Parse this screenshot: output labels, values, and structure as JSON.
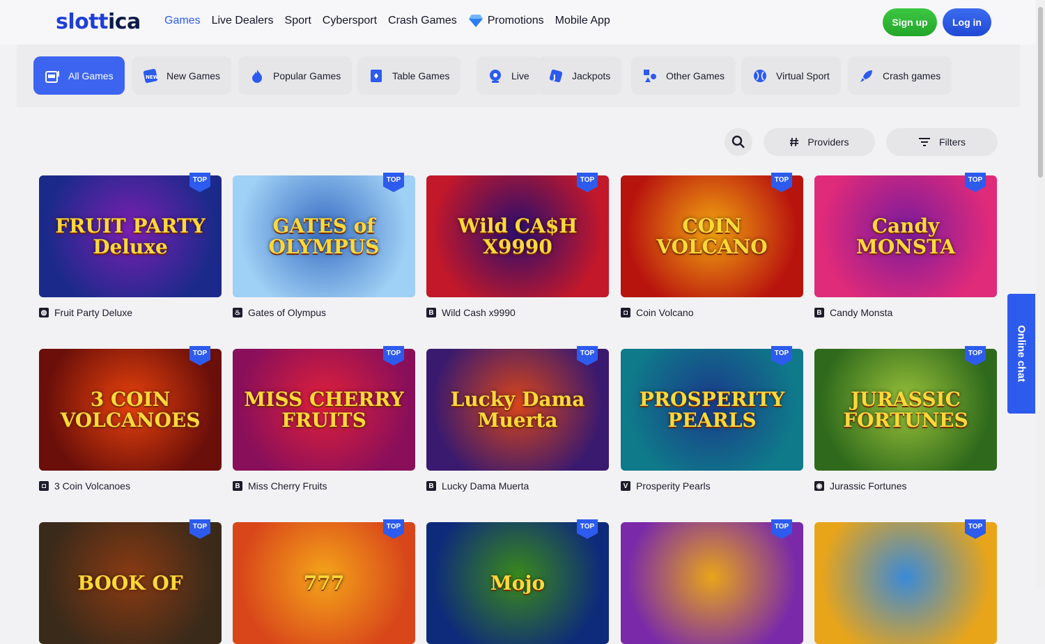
{
  "logo": {
    "part1": "slott",
    "part2": "ica"
  },
  "nav": {
    "items": [
      {
        "label": "Games",
        "active": true
      },
      {
        "label": "Live Dealers"
      },
      {
        "label": "Sport"
      },
      {
        "label": "Cybersport"
      },
      {
        "label": "Crash Games"
      },
      {
        "label": "Promotions",
        "icon": "diamond-icon"
      },
      {
        "label": "Mobile App"
      }
    ]
  },
  "auth": {
    "signup": "Sign up",
    "login": "Log in"
  },
  "categories": [
    {
      "label": "All Games",
      "icon": "slot-machine-icon",
      "active": true
    },
    {
      "label": "New Games",
      "icon": "new-icon"
    },
    {
      "label": "Popular Games",
      "icon": "fire-icon"
    },
    {
      "label": "Table Games",
      "icon": "card-icon"
    },
    {
      "label": "Live",
      "icon": "live-icon"
    },
    {
      "label": "Jackpots",
      "icon": "jackpot-icon"
    },
    {
      "label": "Other Games",
      "icon": "shapes-icon"
    },
    {
      "label": "Virtual Sport",
      "icon": "ball-icon"
    },
    {
      "label": "Crash games",
      "icon": "rocket-icon"
    }
  ],
  "toolbar": {
    "providers": "Providers",
    "filters": "Filters"
  },
  "badge": "TOP",
  "games": [
    {
      "title": "Fruit Party Deluxe",
      "art": "FRUIT PARTY Deluxe",
      "provider_glyph": "◍",
      "bg1": "#1b2a8a",
      "bg2": "#7a1fb0"
    },
    {
      "title": "Gates of Olympus",
      "art": "GATES of OLYMPUS",
      "provider_glyph": "♨",
      "bg1": "#9fd0f5",
      "bg2": "#3a6fc4"
    },
    {
      "title": "Wild Cash x9990",
      "art": "Wild CA$H X9990",
      "provider_glyph": "B",
      "bg1": "#c2182a",
      "bg2": "#2a0e6e"
    },
    {
      "title": "Coin Volcano",
      "art": "COIN VOLCANO",
      "provider_glyph": "◘",
      "bg1": "#b8140e",
      "bg2": "#f2a510"
    },
    {
      "title": "Candy Monsta",
      "art": "Candy MONSTA",
      "provider_glyph": "B",
      "bg1": "#e02a7a",
      "bg2": "#7a1b9c"
    },
    {
      "title": "3 Coin Volcanoes",
      "art": "3 COIN VOLCANOES",
      "provider_glyph": "◘",
      "bg1": "#6a0f0a",
      "bg2": "#e8420c"
    },
    {
      "title": "Miss Cherry Fruits",
      "art": "MISS CHERRY FRUITS",
      "provider_glyph": "B",
      "bg1": "#8a0f5a",
      "bg2": "#e0203a"
    },
    {
      "title": "Lucky Dama Muerta",
      "art": "Lucky Dama Muerta",
      "provider_glyph": "B",
      "bg1": "#3a1a6e",
      "bg2": "#d8451a"
    },
    {
      "title": "Prosperity Pearls",
      "art": "PROSPERITY PEARLS",
      "provider_glyph": "V",
      "bg1": "#0f7a8a",
      "bg2": "#1a3a8a"
    },
    {
      "title": "Jurassic Fortunes",
      "art": "JURASSIC FORTUNES",
      "provider_glyph": "◉",
      "bg1": "#2f6a1c",
      "bg2": "#9ac23a"
    },
    {
      "title": "",
      "art": "BOOK OF",
      "provider_glyph": "",
      "bg1": "#3a2a1a",
      "bg2": "#8a3a12"
    },
    {
      "title": "",
      "art": "777",
      "provider_glyph": "",
      "bg1": "#d8461a",
      "bg2": "#f5a51a"
    },
    {
      "title": "",
      "art": "Mojo",
      "provider_glyph": "",
      "bg1": "#0e2a7a",
      "bg2": "#3a8a1a"
    },
    {
      "title": "",
      "art": "",
      "provider_glyph": "",
      "bg1": "#7a2aa8",
      "bg2": "#e8a51a"
    },
    {
      "title": "",
      "art": "",
      "provider_glyph": "",
      "bg1": "#e8a51a",
      "bg2": "#3a8ad8"
    }
  ],
  "online_chat": "Online chat",
  "colors": {
    "accent": "#2d5bee",
    "signup": "#2fb536",
    "badge": "#2d5bee"
  }
}
